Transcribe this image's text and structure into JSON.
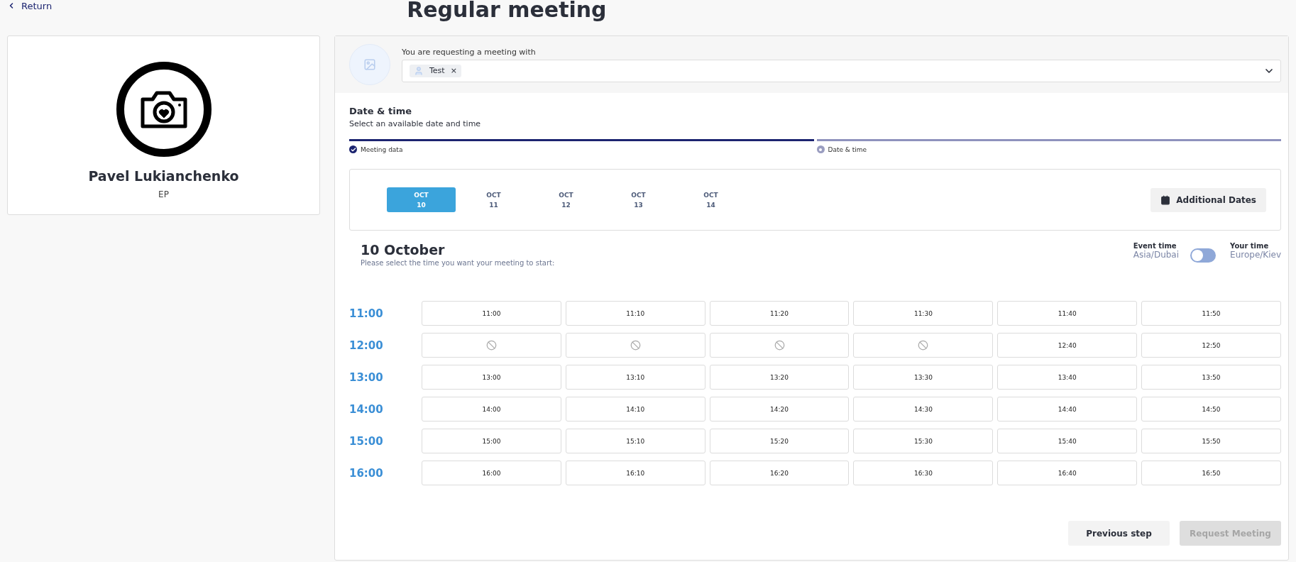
{
  "back_link": "Return",
  "title": "Regular meeting",
  "profile": {
    "name": "Pavel Lukianchenko",
    "role": "EP"
  },
  "request": {
    "label": "You are requesting a meeting with",
    "chips": [
      {
        "label": "Test",
        "remove": "×"
      }
    ]
  },
  "section": {
    "title": "Date & time",
    "subtitle": "Select an available date and time"
  },
  "steps": [
    {
      "label": "Meeting data",
      "done": true
    },
    {
      "label": "Date & time",
      "done": false
    }
  ],
  "dates": [
    {
      "month": "OCT",
      "day": "10",
      "selected": true
    },
    {
      "month": "OCT",
      "day": "11",
      "selected": false
    },
    {
      "month": "OCT",
      "day": "12",
      "selected": false
    },
    {
      "month": "OCT",
      "day": "13",
      "selected": false
    },
    {
      "month": "OCT",
      "day": "14",
      "selected": false
    }
  ],
  "additional_dates": "Additional Dates",
  "day_heading": "10 October",
  "day_hint": "Please select the time you want your meeting to start:",
  "timezone": {
    "event_label": "Event time",
    "event_zone": "Asia/Dubai",
    "your_label": "Your time",
    "your_zone": "Europe/Kiev",
    "on": false
  },
  "hours": [
    {
      "hour": "11:00",
      "slots": [
        {
          "time": "11:00",
          "available": true
        },
        {
          "time": "11:10",
          "available": true
        },
        {
          "time": "11:20",
          "available": true
        },
        {
          "time": "11:30",
          "available": true
        },
        {
          "time": "11:40",
          "available": true
        },
        {
          "time": "11:50",
          "available": true
        }
      ]
    },
    {
      "hour": "12:00",
      "slots": [
        {
          "available": false
        },
        {
          "available": false
        },
        {
          "available": false
        },
        {
          "available": false
        },
        {
          "time": "12:40",
          "available": true
        },
        {
          "time": "12:50",
          "available": true
        }
      ]
    },
    {
      "hour": "13:00",
      "slots": [
        {
          "time": "13:00",
          "available": true
        },
        {
          "time": "13:10",
          "available": true
        },
        {
          "time": "13:20",
          "available": true
        },
        {
          "time": "13:30",
          "available": true
        },
        {
          "time": "13:40",
          "available": true
        },
        {
          "time": "13:50",
          "available": true
        }
      ]
    },
    {
      "hour": "14:00",
      "slots": [
        {
          "time": "14:00",
          "available": true
        },
        {
          "time": "14:10",
          "available": true
        },
        {
          "time": "14:20",
          "available": true
        },
        {
          "time": "14:30",
          "available": true
        },
        {
          "time": "14:40",
          "available": true
        },
        {
          "time": "14:50",
          "available": true
        }
      ]
    },
    {
      "hour": "15:00",
      "slots": [
        {
          "time": "15:00",
          "available": true
        },
        {
          "time": "15:10",
          "available": true
        },
        {
          "time": "15:20",
          "available": true
        },
        {
          "time": "15:30",
          "available": true
        },
        {
          "time": "15:40",
          "available": true
        },
        {
          "time": "15:50",
          "available": true
        }
      ]
    },
    {
      "hour": "16:00",
      "slots": [
        {
          "time": "16:00",
          "available": true
        },
        {
          "time": "16:10",
          "available": true
        },
        {
          "time": "16:20",
          "available": true
        },
        {
          "time": "16:30",
          "available": true
        },
        {
          "time": "16:40",
          "available": true
        },
        {
          "time": "16:50",
          "available": true
        }
      ]
    }
  ],
  "buttons": [
    {
      "label": "Previous step",
      "disabled": false
    },
    {
      "label": "Request Meeting",
      "disabled": true
    }
  ]
}
